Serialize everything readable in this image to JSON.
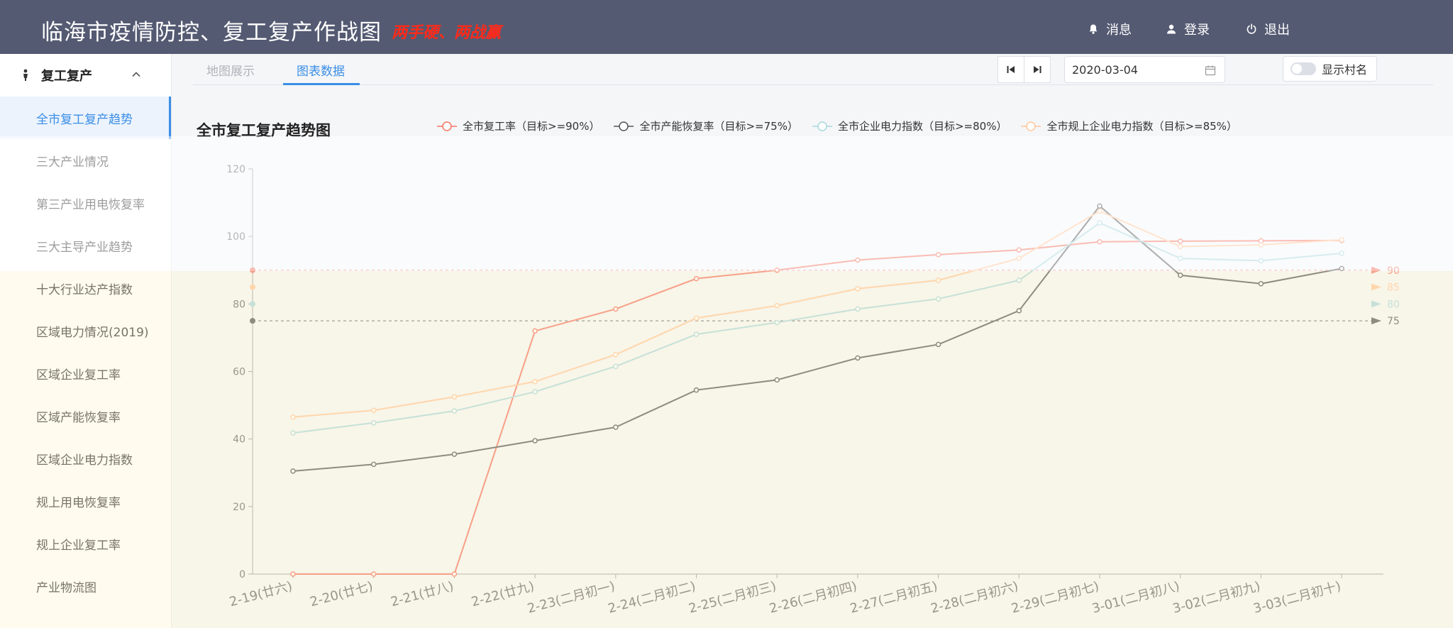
{
  "header": {
    "title": "临海市疫情防控、复工复产作战图",
    "slogan": "两手硬、两战赢",
    "messages": "消息",
    "login": "登录",
    "logout": "退出"
  },
  "sidebar": {
    "group": "复工复产",
    "items": [
      "全市复工复产趋势",
      "三大产业情况",
      "第三产业用电恢复率",
      "三大主导产业趋势",
      "十大行业达产指数",
      "区域电力情况(2019)",
      "区域企业复工率",
      "区域产能恢复率",
      "区域企业电力指数",
      "规上用电恢复率",
      "规上企业复工率",
      "产业物流图"
    ]
  },
  "tabs": [
    "地图展示",
    "图表数据"
  ],
  "date": "2020-03-04",
  "toggle_label": "显示村名",
  "colors": {
    "header_bg": "#545a72",
    "accent": "#3a8ee6",
    "series_rework": "#f37562",
    "series_capacity": "#555555",
    "series_power": "#a9d8dd",
    "series_above": "#ffc79c"
  },
  "chart_data": {
    "type": "line",
    "title": "全市复工复产趋势图",
    "x": [
      "2-19(廿六)",
      "2-20(廿七)",
      "2-21(廿八)",
      "2-22(廿九)",
      "2-23(二月初一)",
      "2-24(二月初二)",
      "2-25(二月初三)",
      "2-26(二月初四)",
      "2-27(二月初五)",
      "2-28(二月初六)",
      "2-29(二月初七)",
      "3-01(二月初八)",
      "3-02(二月初九)",
      "3-03(二月初十)"
    ],
    "ylim": [
      0,
      120
    ],
    "yticks": [
      0,
      20,
      40,
      60,
      80,
      100,
      120
    ],
    "series": [
      {
        "name": "全市复工率（目标>=90%）",
        "color": "#f37562",
        "values": [
          0,
          0,
          0,
          72,
          78.5,
          87.5,
          90,
          93,
          94.6,
          96,
          98.4,
          98.6,
          98.7,
          98.8
        ]
      },
      {
        "name": "全市产能恢复率（目标>=75%）",
        "color": "#555555",
        "values": [
          30.5,
          32.5,
          35.5,
          39.5,
          43.5,
          54.5,
          57.5,
          64,
          68,
          78,
          109,
          88.5,
          86,
          90.5
        ]
      },
      {
        "name": "全市企业电力指数（目标>=80%）",
        "color": "#a9d8dd",
        "values": [
          41.8,
          44.8,
          48.3,
          54,
          61.5,
          71,
          74.5,
          78.5,
          81.5,
          87,
          104,
          93.5,
          92.8,
          95
        ]
      },
      {
        "name": "全市规上企业电力指数（目标>=85%）",
        "color": "#ffc79c",
        "values": [
          46.5,
          48.5,
          52.5,
          57,
          65,
          75.8,
          79.5,
          84.5,
          87,
          93.5,
          107.5,
          97,
          97.5,
          99
        ]
      }
    ],
    "targets": [
      {
        "value": 90,
        "label": "90",
        "color": "#f37562",
        "line": true
      },
      {
        "value": 85,
        "label": "85",
        "color": "#ffc79c",
        "line": false
      },
      {
        "value": 80,
        "label": "80",
        "color": "#a9d8dd",
        "line": false
      },
      {
        "value": 75,
        "label": "75",
        "color": "#555555",
        "line": true
      }
    ]
  }
}
